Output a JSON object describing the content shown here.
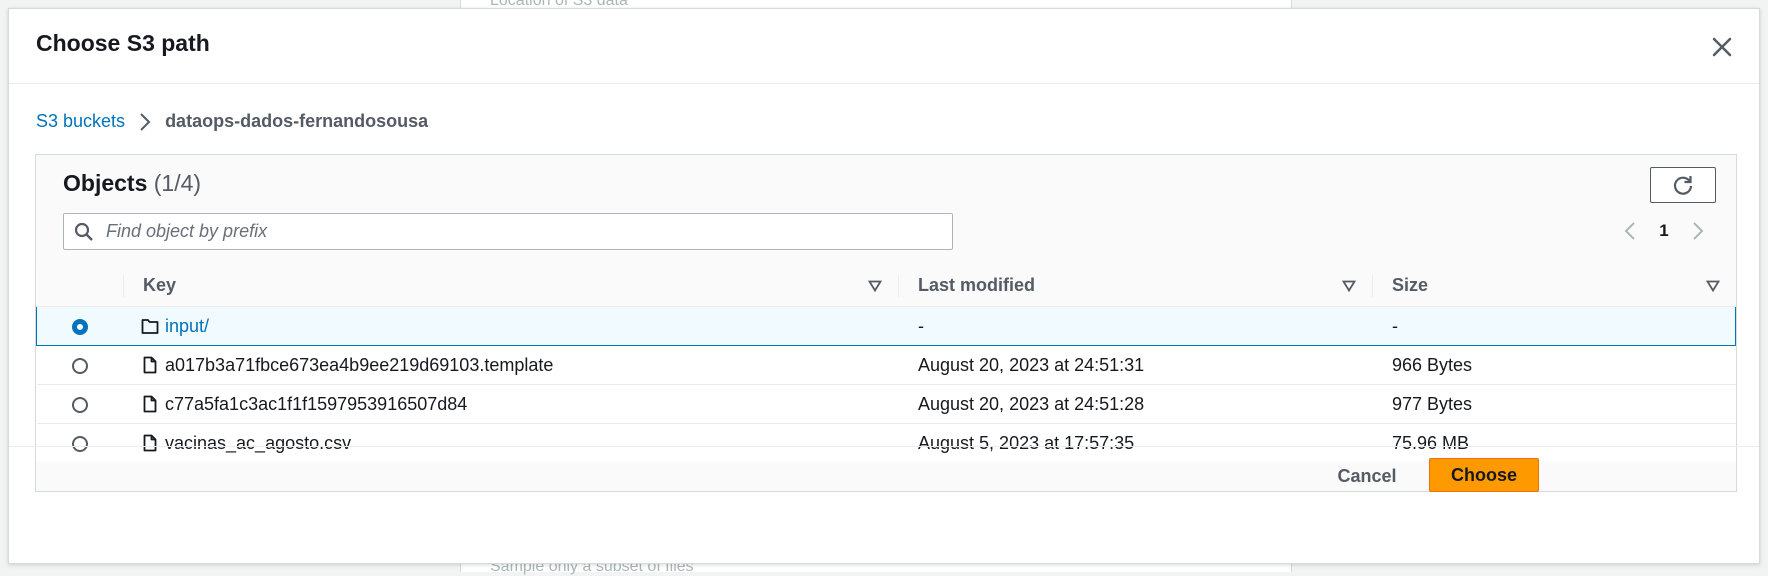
{
  "background": {
    "top_hint": "Location of S3 data",
    "bottom_hint": "Sample only a subset of files"
  },
  "modal": {
    "title": "Choose S3 path",
    "close_icon": "close-icon"
  },
  "breadcrumb": {
    "root": "S3 buckets",
    "current": "dataops-dados-fernandosousa"
  },
  "objects": {
    "title": "Objects",
    "count": "(1/4)",
    "refresh_icon": "refresh-icon",
    "search_placeholder": "Find object by prefix",
    "search_value": "",
    "page": "1"
  },
  "table": {
    "columns": [
      "Key",
      "Last modified",
      "Size"
    ],
    "rows": [
      {
        "key": "input/",
        "type": "folder",
        "last_modified": "-",
        "size": "-",
        "selected": true
      },
      {
        "key": "a017b3a71fbce673ea4b9ee219d69103.template",
        "type": "file",
        "last_modified": "August 20, 2023 at 24:51:31",
        "size": "966 Bytes",
        "selected": false
      },
      {
        "key": "c77a5fa1c3ac1f1f1597953916507d84",
        "type": "file",
        "last_modified": "August 20, 2023 at 24:51:28",
        "size": "977 Bytes",
        "selected": false
      },
      {
        "key": "vacinas_ac_agosto.csv",
        "type": "file",
        "last_modified": "August 5, 2023 at 17:57:35",
        "size": "75.96 MB",
        "selected": false
      }
    ]
  },
  "footer": {
    "cancel_label": "Cancel",
    "choose_label": "Choose"
  },
  "colors": {
    "link": "#0073bb",
    "primary_button": "#ff9900",
    "selected_row_bg": "#f1faff"
  }
}
